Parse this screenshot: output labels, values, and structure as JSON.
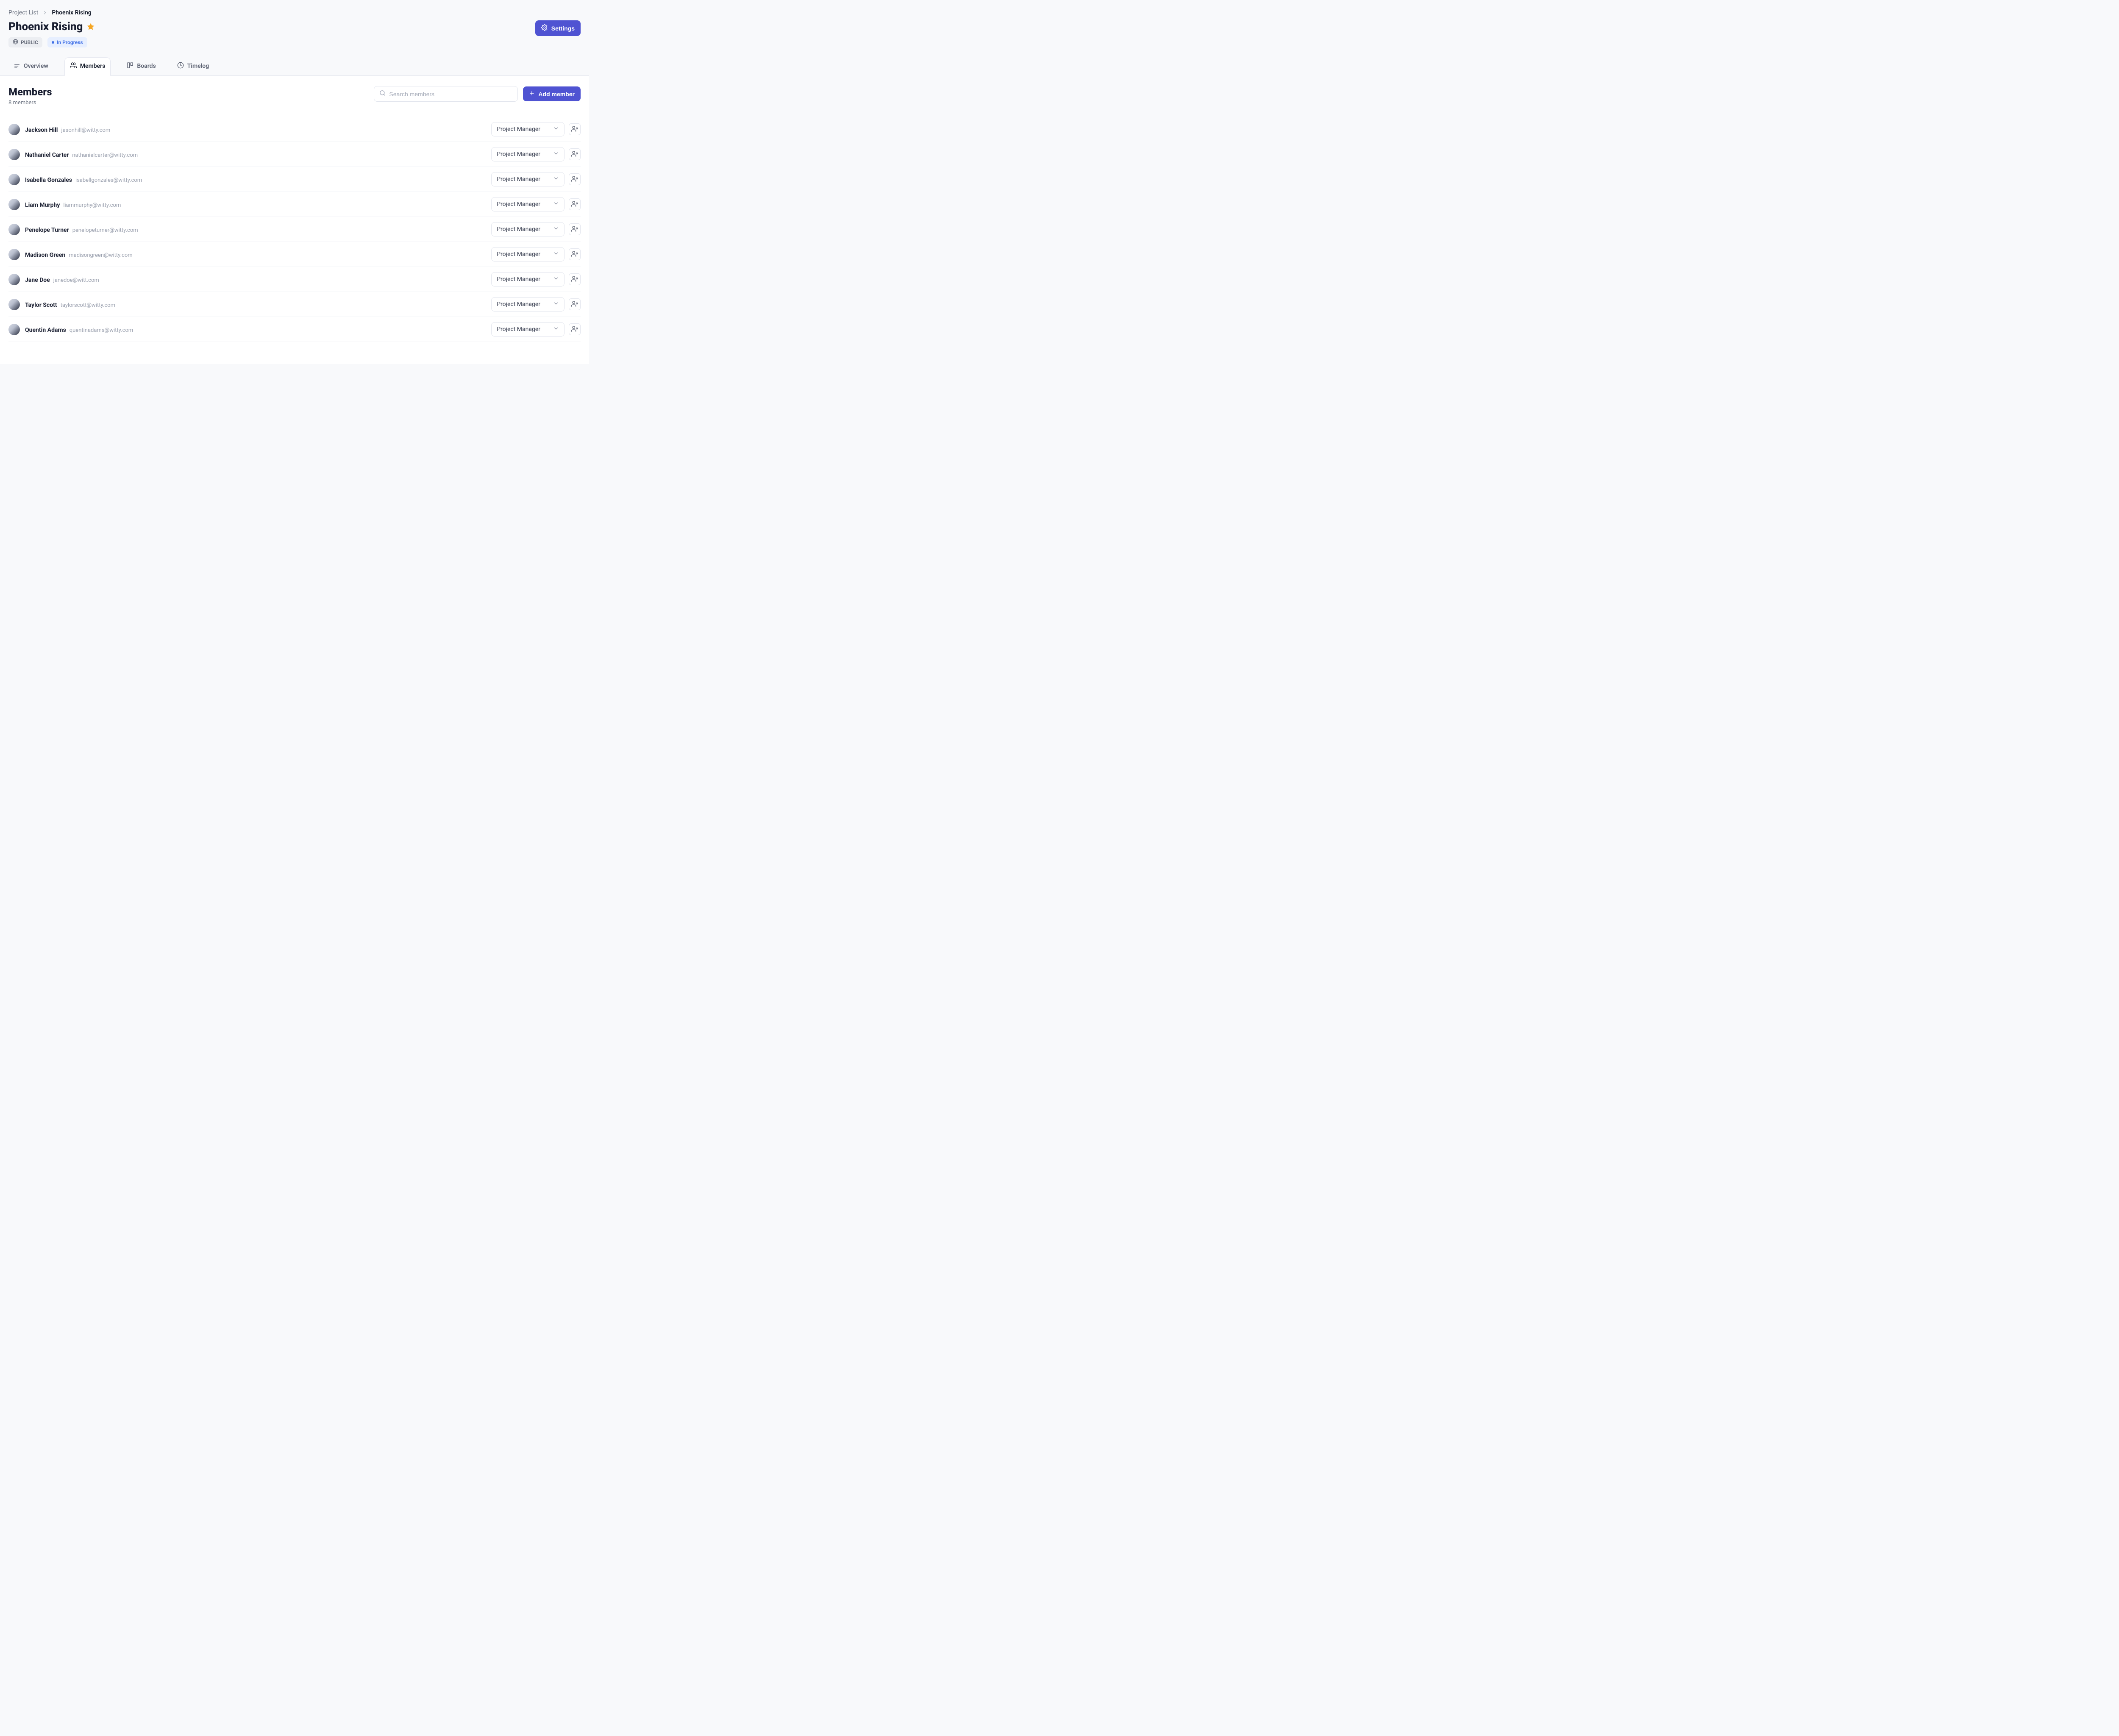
{
  "breadcrumb": {
    "root": "Project List",
    "current": "Phoenix Rising"
  },
  "header": {
    "title": "Phoenix Rising",
    "settings_label": "Settings",
    "badges": {
      "public": "PUBLIC",
      "progress": "In Progress"
    }
  },
  "tabs": {
    "overview": "Overview",
    "members": "Members",
    "boards": "Boards",
    "timelog": "Timelog",
    "active": "members"
  },
  "section": {
    "title": "Members",
    "subtitle": "8 members",
    "search_placeholder": "Search members",
    "add_label": "Add member"
  },
  "role_label": "Project Manager",
  "members": [
    {
      "name": "Jackson Hill",
      "email": "jasonhill@witty.com"
    },
    {
      "name": "Nathaniel Carter",
      "email": "nathanielcarter@witty.com"
    },
    {
      "name": "Isabella Gonzales",
      "email": "isabellgonzales@witty.com"
    },
    {
      "name": "Liam Murphy",
      "email": "liammurphy@witty.com"
    },
    {
      "name": "Penelope Turner",
      "email": "penelopeturner@witty.com"
    },
    {
      "name": "Madison Green",
      "email": "madisongreen@witty.com"
    },
    {
      "name": "Jane Doe",
      "email": "janedoe@witt.com"
    },
    {
      "name": "Taylor Scott",
      "email": "taylorscott@witty.com"
    },
    {
      "name": "Quentin Adams",
      "email": "quentinadams@witty.com"
    }
  ]
}
